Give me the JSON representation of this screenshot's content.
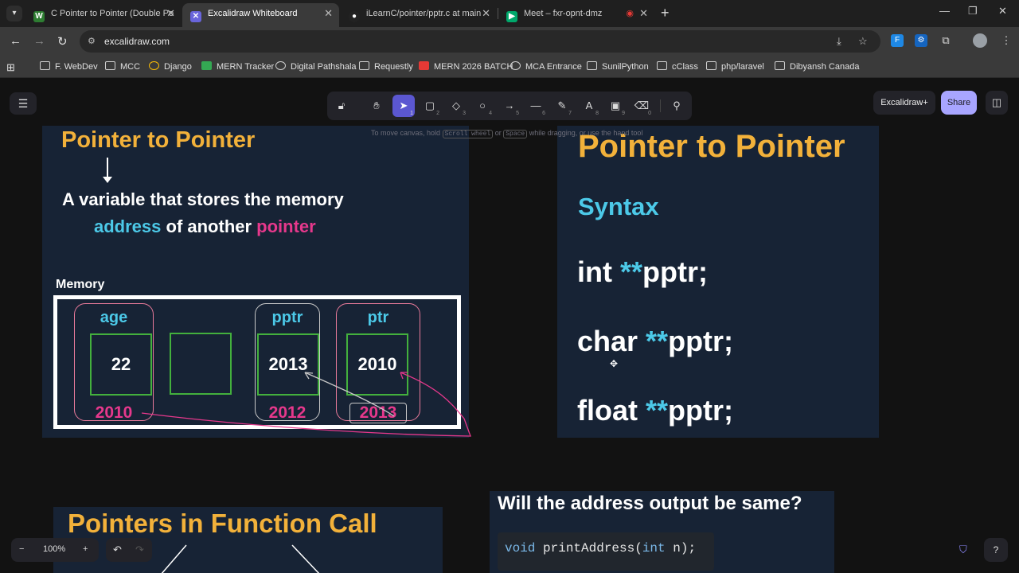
{
  "browser": {
    "tabs": [
      {
        "title": "C Pointer to Pointer (Double Po",
        "favicon": "W",
        "favicon_color": "#2e7d32"
      },
      {
        "title": "Excalidraw Whiteboard",
        "favicon": "✕",
        "favicon_color": "#6965db"
      },
      {
        "title": "iLearnC/pointer/pptr.c at main",
        "favicon": "●",
        "favicon_color": "#ffffff"
      },
      {
        "title": "Meet – fxr-opnt-dmz",
        "favicon": "▶",
        "favicon_color": "#00a86b"
      }
    ],
    "url": "excalidraw.com",
    "bookmarks": [
      "F. WebDev",
      "MCC",
      "Django",
      "MERN Tracker",
      "Digital Pathshala",
      "Requestly",
      "MERN 2026 BATCH",
      "MCA Entrance",
      "SunilPython",
      "cClass",
      "php/laravel",
      "Dibyansh Canada"
    ]
  },
  "excalidraw": {
    "tool_shortcuts": [
      "",
      "",
      "1",
      "2",
      "3",
      "4",
      "5",
      "6",
      "7",
      "8",
      "9",
      "0",
      ""
    ],
    "hint": {
      "pre": "To move canvas, hold",
      "key1": "Scroll wheel",
      "mid": "or",
      "key2": "Space",
      "post": "while dragging, or use the hand tool"
    },
    "plus_label": "Excalidraw+",
    "share_label": "Share",
    "zoom": "100%"
  },
  "slide1": {
    "title": "Pointer to Pointer",
    "line1": "A variable that stores the memory",
    "line2_a": "address",
    "line2_b": " of another ",
    "line2_c": "pointer",
    "memory_label": "Memory",
    "cells": {
      "age_name": "age",
      "age_value": "22",
      "age_addr": "2010",
      "pptr_name": "pptr",
      "pptr_value": "2013",
      "pptr_addr": "2012",
      "ptr_name": "ptr",
      "ptr_value": "2010",
      "ptr_addr": "2013"
    }
  },
  "slide2": {
    "title": "Pointer to Pointer",
    "syntax": "Syntax",
    "lines": [
      {
        "type": "int ",
        "stars": "**",
        "name": "pptr;"
      },
      {
        "type": "char ",
        "stars": "**",
        "name": "pptr;"
      },
      {
        "type": "float ",
        "stars": "**",
        "name": "pptr;"
      }
    ]
  },
  "slide3": {
    "title": "Pointers in Function Call"
  },
  "slide4": {
    "title": "Will the address output be same?",
    "code_kw1": "void",
    "code_fn": " printAddress(",
    "code_kw2": "int",
    "code_rest": " n);"
  },
  "colors": {
    "title": "#f2b13a",
    "accent_blue": "#4cc9e8",
    "accent_pink": "#e6388c",
    "cell_green": "#43b03d",
    "selected_tool": "#5b57d1",
    "share": "#a8a5ff"
  }
}
